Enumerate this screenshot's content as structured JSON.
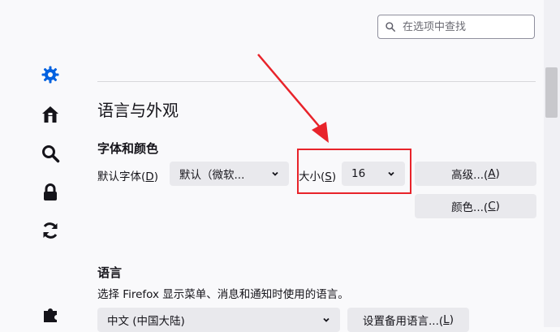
{
  "search": {
    "placeholder": "在选项中查找"
  },
  "sidebar": {
    "items": [
      {
        "name": "general",
        "icon": "gear-icon",
        "active": true
      },
      {
        "name": "home",
        "icon": "home-icon"
      },
      {
        "name": "search",
        "icon": "search-icon"
      },
      {
        "name": "privacy",
        "icon": "lock-icon"
      },
      {
        "name": "sync",
        "icon": "sync-icon"
      },
      {
        "name": "extensions",
        "icon": "puzzle-icon"
      }
    ]
  },
  "main": {
    "section_title": "语言与外观",
    "fonts": {
      "heading": "字体和颜色",
      "default_font_label": "默认字体(",
      "default_font_key": "D",
      "default_font_close": ")",
      "default_font_value": "默认（微软...",
      "size_label": "大小(",
      "size_key": "S",
      "size_close": ")",
      "size_value": "16",
      "advanced_label": "高级...(",
      "advanced_key": "A",
      "advanced_close": ")",
      "colors_label": "颜色...(",
      "colors_key": "C",
      "colors_close": ")"
    },
    "language": {
      "heading": "语言",
      "description": "选择 Firefox 显示菜单、消息和通知时使用的语言。",
      "language_value": "中文 (中国大陆)",
      "alternatives_label": "设置备用语言...(",
      "alternatives_key": "L",
      "alternatives_close": ")"
    }
  },
  "colors": {
    "accent": "#0061e0",
    "highlight": "#e8232a"
  }
}
